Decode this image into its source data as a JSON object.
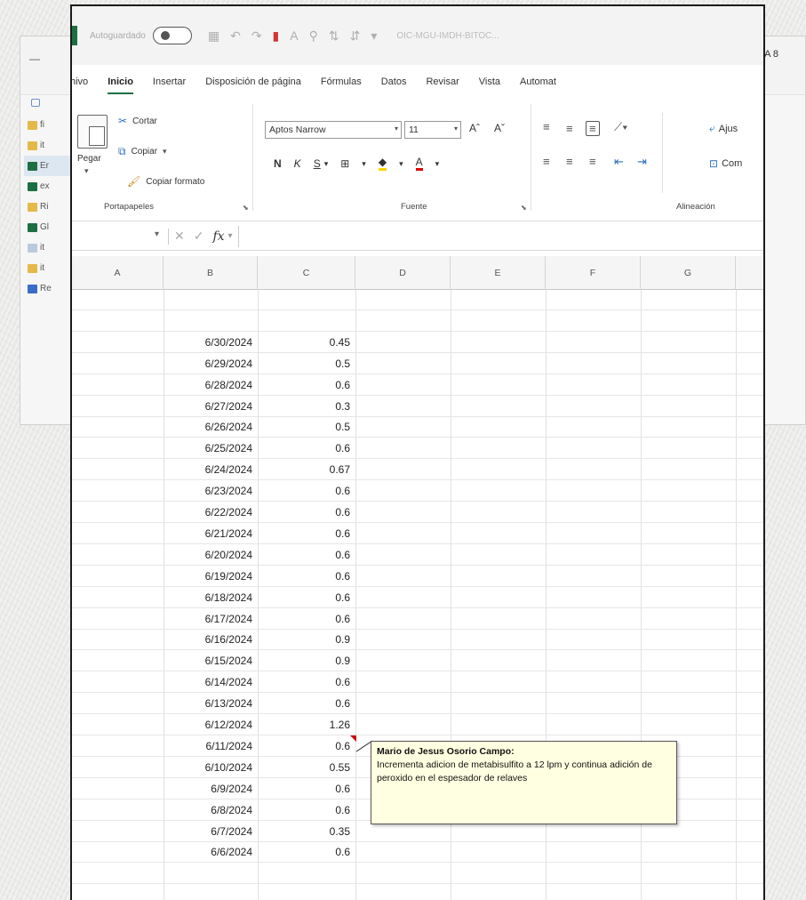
{
  "background_window": {
    "minimize": "—",
    "corner_text": "A 8",
    "nav_items": [
      {
        "icon": "folder-icon",
        "label": "fi",
        "color": "#e5b84a"
      },
      {
        "icon": "folder-icon",
        "label": "it",
        "color": "#e5b84a"
      },
      {
        "icon": "excel-file-icon",
        "label": "Er",
        "color": "#1d6f42",
        "selected": true
      },
      {
        "icon": "excel-file-icon",
        "label": "ex",
        "color": "#1d6f42"
      },
      {
        "icon": "folder-icon",
        "label": "Ri",
        "color": "#e5b84a"
      },
      {
        "icon": "excel-file-icon",
        "label": "Gl",
        "color": "#1d6f42"
      },
      {
        "icon": "file-icon",
        "label": "it",
        "color": "#b9c9e0"
      },
      {
        "icon": "folder-icon",
        "label": "it",
        "color": "#e5b84a"
      },
      {
        "icon": "document-icon",
        "label": "Re",
        "color": "#3b6cc7"
      }
    ]
  },
  "titlebar": {
    "autosave_label": "Autoguardado",
    "toggle_state": "off",
    "filename": "OIC-MGU-IMDH-BITOC..."
  },
  "tabs": [
    {
      "label": "hivo",
      "active": false
    },
    {
      "label": "Inicio",
      "active": true
    },
    {
      "label": "Insertar",
      "active": false
    },
    {
      "label": "Disposición de página",
      "active": false
    },
    {
      "label": "Fórmulas",
      "active": false
    },
    {
      "label": "Datos",
      "active": false
    },
    {
      "label": "Revisar",
      "active": false
    },
    {
      "label": "Vista",
      "active": false
    },
    {
      "label": "Automat",
      "active": false
    }
  ],
  "ribbon": {
    "clipboard": {
      "paste_label": "Pegar",
      "cut_label": "Cortar",
      "copy_label": "Copiar",
      "format_painter_label": "Copiar formato",
      "group_label": "Portapapeles"
    },
    "font": {
      "font_name": "Aptos Narrow",
      "font_size": "11",
      "grow_label": "Aˆ",
      "shrink_label": "Aˇ",
      "bold": "N",
      "italic": "K",
      "underline": "S",
      "group_label": "Fuente"
    },
    "alignment": {
      "wrap_label": "Ajus",
      "merge_label": "Com",
      "group_label": "Alineación"
    }
  },
  "formula_bar": {
    "fx_label": "fx",
    "value": ""
  },
  "columns": [
    "A",
    "B",
    "C",
    "D",
    "E",
    "F",
    "G"
  ],
  "rows": [
    {
      "date": "",
      "value": ""
    },
    {
      "date": "",
      "value": ""
    },
    {
      "date": "6/30/2024",
      "value": "0.45"
    },
    {
      "date": "6/29/2024",
      "value": "0.5"
    },
    {
      "date": "6/28/2024",
      "value": "0.6"
    },
    {
      "date": "6/27/2024",
      "value": "0.3"
    },
    {
      "date": "6/26/2024",
      "value": "0.5"
    },
    {
      "date": "6/25/2024",
      "value": "0.6"
    },
    {
      "date": "6/24/2024",
      "value": "0.67"
    },
    {
      "date": "6/23/2024",
      "value": "0.6"
    },
    {
      "date": "6/22/2024",
      "value": "0.6"
    },
    {
      "date": "6/21/2024",
      "value": "0.6"
    },
    {
      "date": "6/20/2024",
      "value": "0.6"
    },
    {
      "date": "6/19/2024",
      "value": "0.6"
    },
    {
      "date": "6/18/2024",
      "value": "0.6"
    },
    {
      "date": "6/17/2024",
      "value": "0.6"
    },
    {
      "date": "6/16/2024",
      "value": "0.9"
    },
    {
      "date": "6/15/2024",
      "value": "0.9"
    },
    {
      "date": "6/14/2024",
      "value": "0.6"
    },
    {
      "date": "6/13/2024",
      "value": "0.6"
    },
    {
      "date": "6/12/2024",
      "value": "1.26"
    },
    {
      "date": "6/11/2024",
      "value": "0.6"
    },
    {
      "date": "6/10/2024",
      "value": "0.55"
    },
    {
      "date": "6/9/2024",
      "value": "0.6"
    },
    {
      "date": "6/8/2024",
      "value": "0.6"
    },
    {
      "date": "6/7/2024",
      "value": "0.35"
    },
    {
      "date": "6/6/2024",
      "value": "0.6"
    },
    {
      "date": "",
      "value": ""
    },
    {
      "date": "",
      "value": ""
    },
    {
      "date": "",
      "value": ""
    }
  ],
  "comment": {
    "author": "Mario de Jesus Osorio Campo:",
    "text": "Incrementa adicion de metabisulfito a 12 lpm y continua adición de peroxido en el espesador de relaves"
  }
}
